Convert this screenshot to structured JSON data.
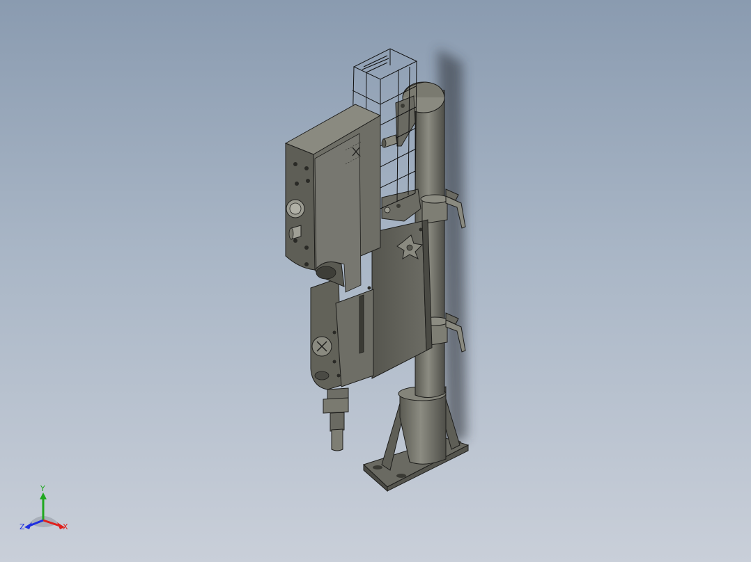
{
  "viewport": {
    "background_top": "#8a9bb0",
    "background_bottom": "#c9cfd9"
  },
  "model": {
    "body_color": "#6e6e66",
    "body_dark": "#4a4a44",
    "edge_color": "#1e1e1c",
    "column_color": "#7a7a70",
    "handle_color": "#8a8a80"
  },
  "triad": {
    "x_label": "X",
    "y_label": "Y",
    "z_label": "Z",
    "x_color": "#e0201c",
    "y_color": "#1fa81f",
    "z_color": "#1f2fe0"
  }
}
